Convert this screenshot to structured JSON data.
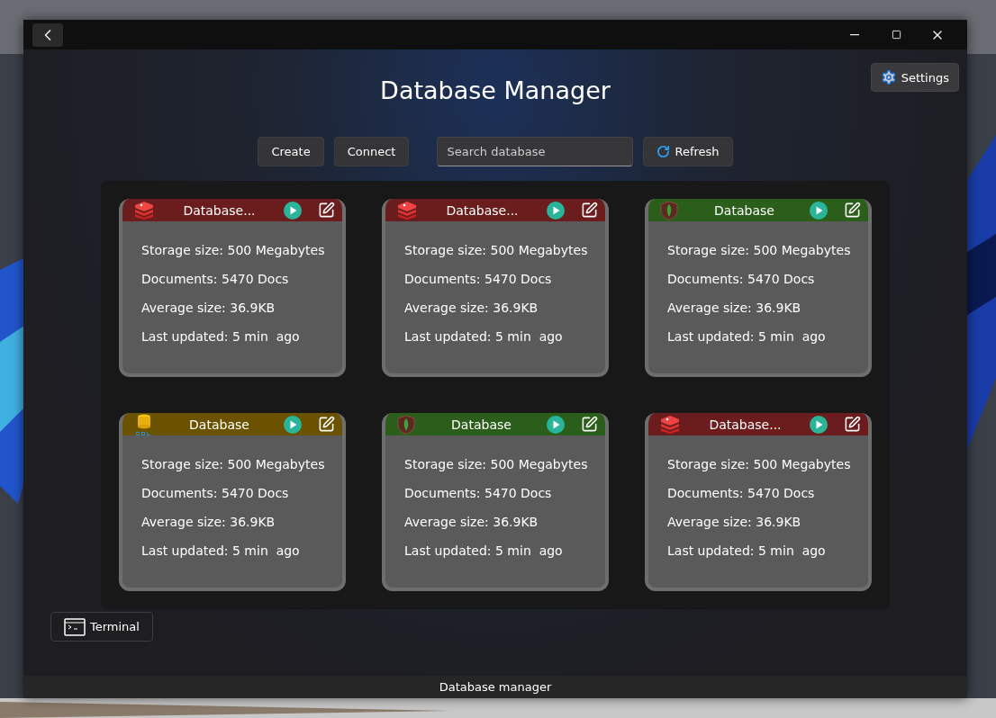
{
  "window": {
    "title": "Database Manager"
  },
  "settings_button": "Settings",
  "toolbar": {
    "buttons": [
      "Create",
      "Connect"
    ],
    "search": {
      "placeholder": "Search database"
    },
    "refresh": "Refresh"
  },
  "cards": [
    {
      "kind": "redis",
      "color": "#6b1c1c",
      "title": "Database...",
      "stats": [
        "Storage size: 500 Megabytes",
        "Documents: 5470 Docs",
        "Average size: 36.9KB",
        "Last updated: 5 min  ago"
      ]
    },
    {
      "kind": "redis",
      "color": "#6b1c1c",
      "title": "Database...",
      "stats": [
        "Storage size: 500 Megabytes",
        "Documents: 5470 Docs",
        "Average size: 36.9KB",
        "Last updated: 5 min  ago"
      ]
    },
    {
      "kind": "mongo",
      "color": "#2a5e1a",
      "title": "Database",
      "stats": [
        "Storage size: 500 Megabytes",
        "Documents: 5470 Docs",
        "Average size: 36.9KB",
        "Last updated: 5 min  ago"
      ]
    },
    {
      "kind": "sql",
      "color": "#6b5200",
      "title": "Database",
      "stats": [
        "Storage size: 500 Megabytes",
        "Documents: 5470 Docs",
        "Average size: 36.9KB",
        "Last updated: 5 min  ago"
      ]
    },
    {
      "kind": "mongo",
      "color": "#2a5e1a",
      "title": "Database",
      "stats": [
        "Storage size: 500 Megabytes",
        "Documents: 5470 Docs",
        "Average size: 36.9KB",
        "Last updated: 5 min  ago"
      ]
    },
    {
      "kind": "redis",
      "color": "#6b1c1c",
      "title": "Database...",
      "stats": [
        "Storage size: 500 Megabytes",
        "Documents: 5470 Docs",
        "Average size: 36.9KB",
        "Last updated: 5 min  ago"
      ]
    }
  ],
  "terminal_button": "Terminal",
  "status_bar": "Database manager"
}
